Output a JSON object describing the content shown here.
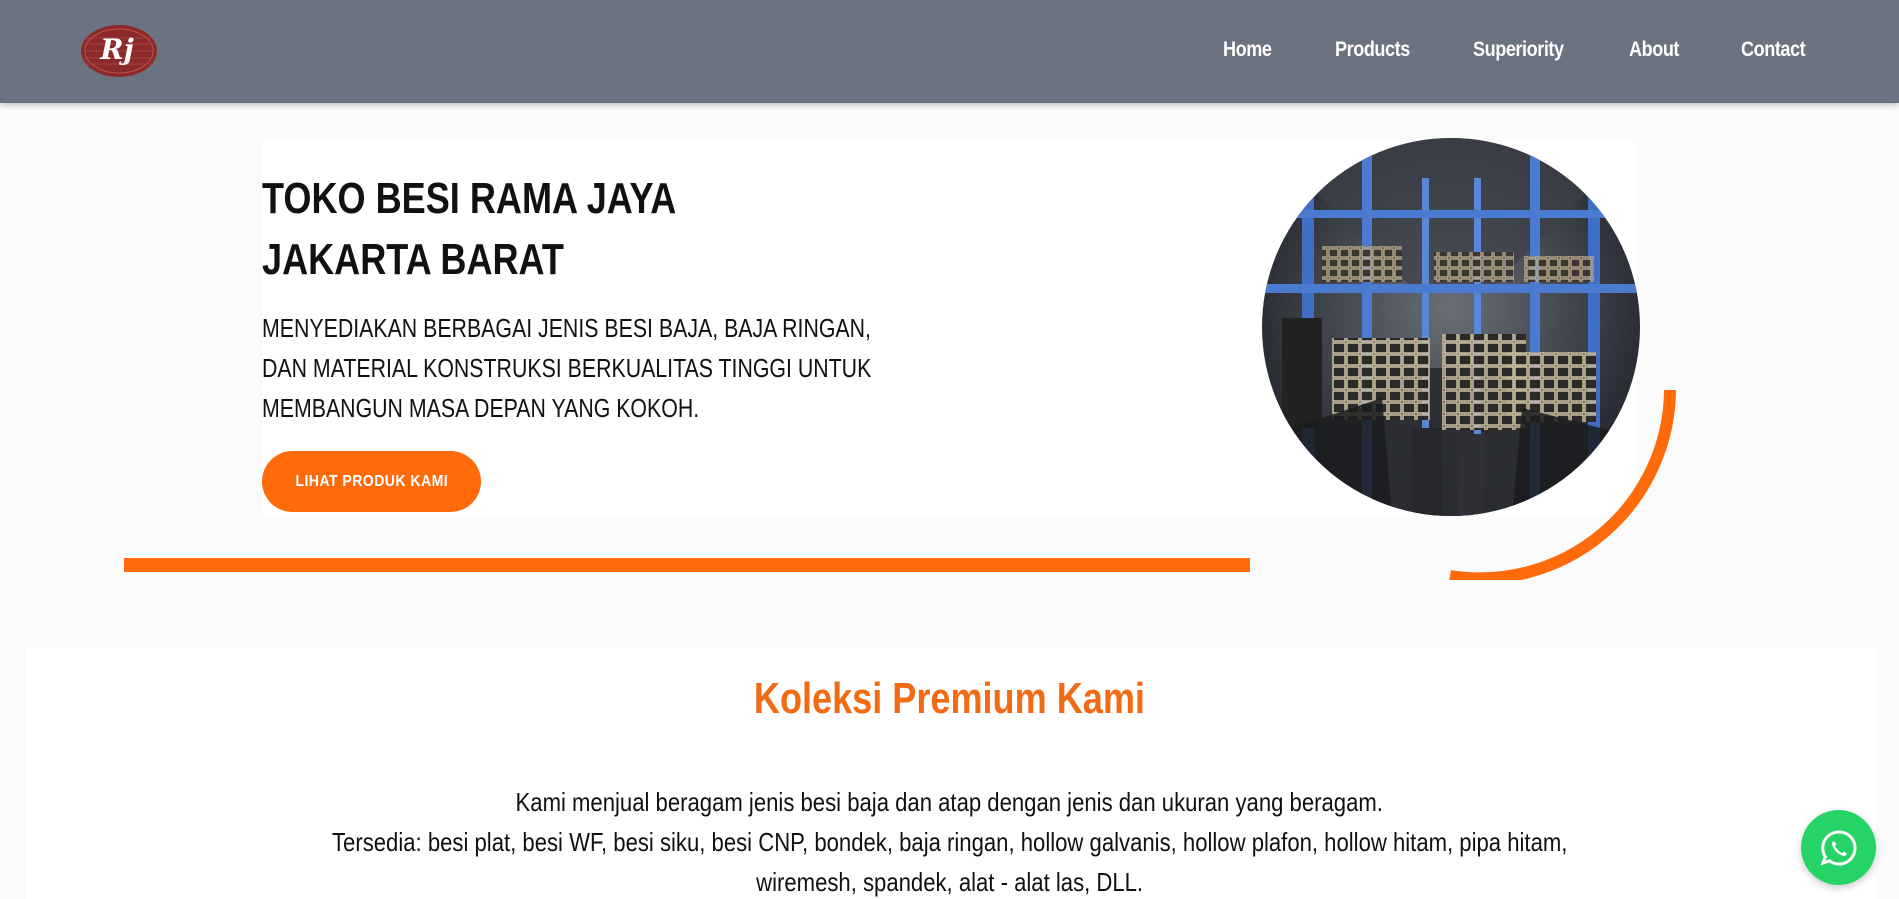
{
  "header": {
    "logo_text": "Rj",
    "nav": [
      {
        "label": "Home"
      },
      {
        "label": "Products"
      },
      {
        "label": "Superiority"
      },
      {
        "label": "About"
      },
      {
        "label": "Contact"
      }
    ]
  },
  "hero": {
    "title_line1": "TOKO BESI RAMA JAYA",
    "title_line2": "JAKARTA BARAT",
    "desc_line1": "MENYEDIAKAN BERBAGAI JENIS BESI BAJA, BAJA RINGAN,",
    "desc_line2": "DAN MATERIAL KONSTRUKSI BERKUALITAS TINGGI UNTUK",
    "desc_line3": "MEMBANGUN MASA DEPAN YANG KOKOH.",
    "cta_label": "LIHAT PRODUK KAMI"
  },
  "collection": {
    "title": "Koleksi Premium Kami",
    "desc_line1": "Kami menjual beragam jenis besi baja dan atap dengan jenis dan ukuran yang beragam.",
    "desc_line2": "Tersedia: besi plat, besi WF, besi siku, besi CNP, bondek, baja ringan, hollow galvanis, hollow plafon, hollow hitam, pipa hitam,",
    "desc_line3": "wiremesh, spandek, alat - alat las, DLL."
  },
  "icons": {
    "whatsapp": "whatsapp-icon",
    "logo": "rj-logo"
  },
  "colors": {
    "navbar": "#6b7280",
    "accent": "#ff6a0a",
    "title_accent": "#f26a11",
    "whatsapp": "#25d366"
  }
}
